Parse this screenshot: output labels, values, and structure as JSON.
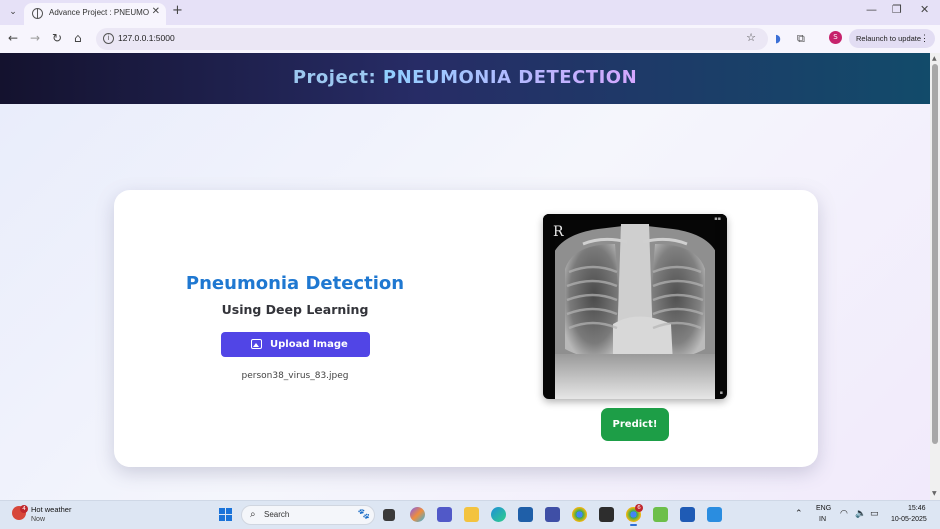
{
  "browser": {
    "tab": {
      "title": "Advance Project : PNEUMONIA",
      "close": "✕"
    },
    "new_tab": "+",
    "window": {
      "minimize": "—",
      "restore": "❐",
      "close": "✕"
    },
    "url": "127.0.0.1:5000",
    "profile_initial": "S",
    "relaunch_label": "Relaunch to update"
  },
  "page": {
    "header": {
      "prefix": "Project: ",
      "accent": "PNEUMONIA DETECTION"
    },
    "title": "Pneumonia Detection",
    "subtitle": "Using Deep Learning",
    "upload_label": "Upload Image",
    "file_name": "person38_virus_83.jpeg",
    "xray_marker": "R",
    "predict_label": "Predict!"
  },
  "taskbar": {
    "weather_title": "Hot weather",
    "weather_sub": "Now",
    "weather_badge": "4",
    "search_placeholder": "Search",
    "chrome_badge": "6",
    "lang_line1": "ENG",
    "lang_line2": "IN",
    "time": "15:46",
    "date": "10-05-2025"
  },
  "colors": {
    "header_start": "#14122e",
    "header_end": "#124b6a",
    "title_blue": "#1f78d1",
    "upload_button": "#5145e6",
    "predict_button": "#1d9e47"
  }
}
